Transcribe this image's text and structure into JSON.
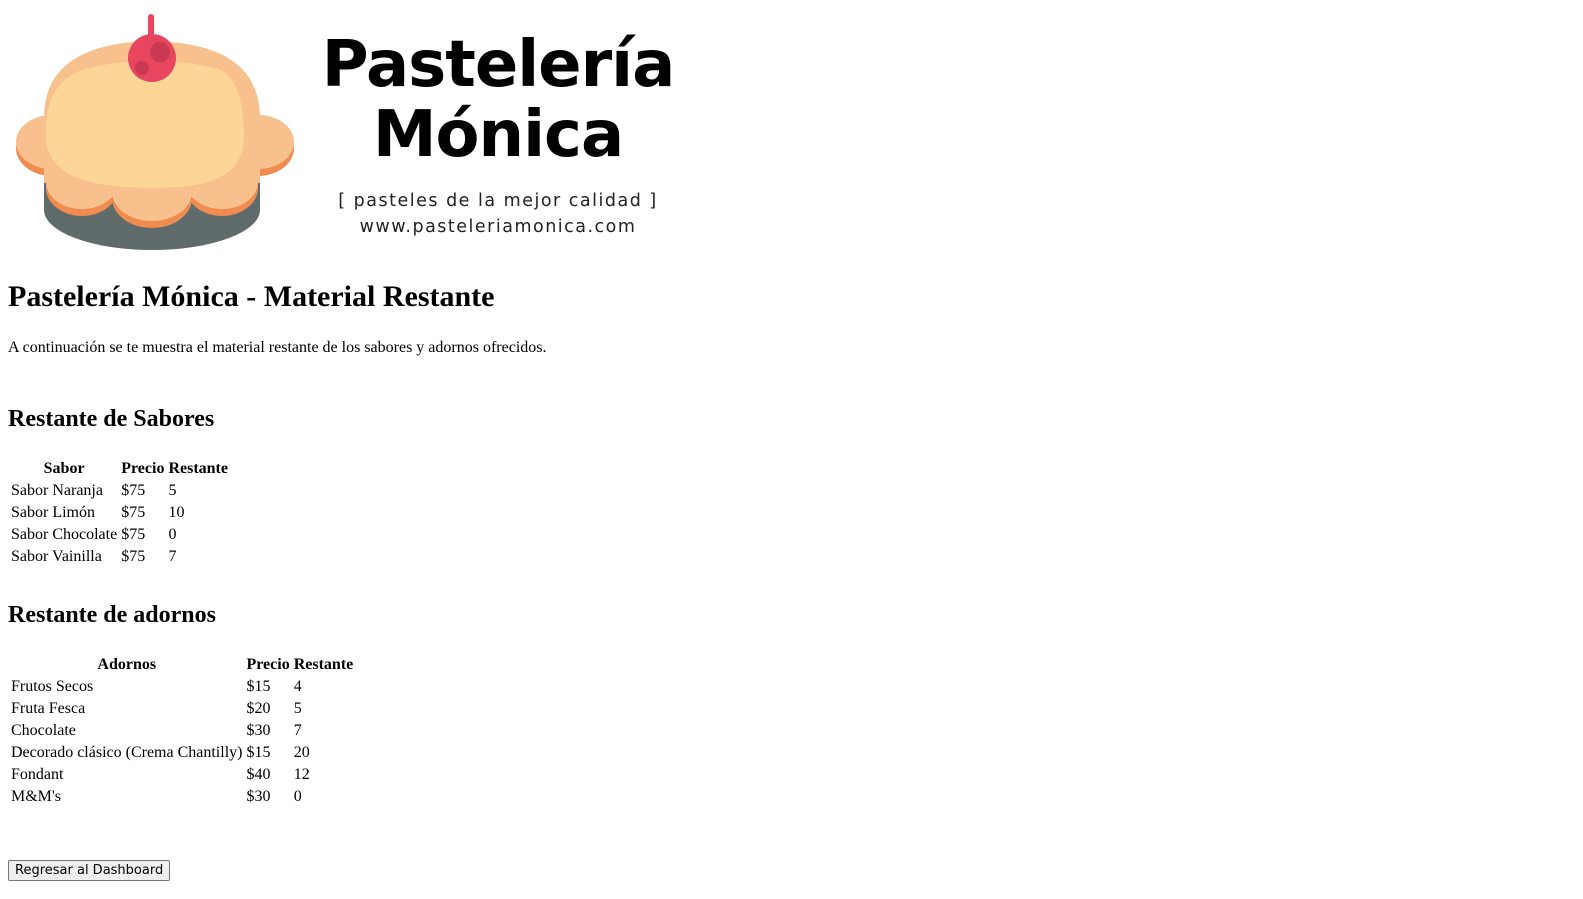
{
  "logo": {
    "name_line1": "Pastelería",
    "name_line2": "Mónica",
    "tagline": "[ pasteles de la mejor calidad ]",
    "website": "www.pasteleriamonica.com"
  },
  "page_title": "Pastelería Mónica - Material Restante",
  "intro": "A continuación se te muestra el material restante de los sabores y adornos ofrecidos.",
  "sabores": {
    "title": "Restante de Sabores",
    "headers": [
      "Sabor",
      "Precio",
      "Restante"
    ],
    "rows": [
      [
        "Sabor Naranja",
        "$75",
        "5"
      ],
      [
        "Sabor Limón",
        "$75",
        "10"
      ],
      [
        "Sabor Chocolate",
        "$75",
        "0"
      ],
      [
        "Sabor Vainilla",
        "$75",
        "7"
      ]
    ]
  },
  "adornos": {
    "title": "Restante de adornos",
    "headers": [
      "Adornos",
      "Precio",
      "Restante"
    ],
    "rows": [
      [
        "Frutos Secos",
        "$15",
        "4"
      ],
      [
        "Fruta Fesca",
        "$20",
        "5"
      ],
      [
        "Chocolate",
        "$30",
        "7"
      ],
      [
        "Decorado clásico (Crema Chantilly)",
        "$15",
        "20"
      ],
      [
        "Fondant",
        "$40",
        "12"
      ],
      [
        "M&M's",
        "$30",
        "0"
      ]
    ]
  },
  "back_button": "Regresar al Dashboard",
  "colors": {
    "cupcake_top": "#fdd596",
    "cupcake_frosting": "#f8c08c",
    "cupcake_edge": "#f08c50",
    "cupcake_base": "#5f6b6b",
    "cherry": "#e8455f"
  }
}
